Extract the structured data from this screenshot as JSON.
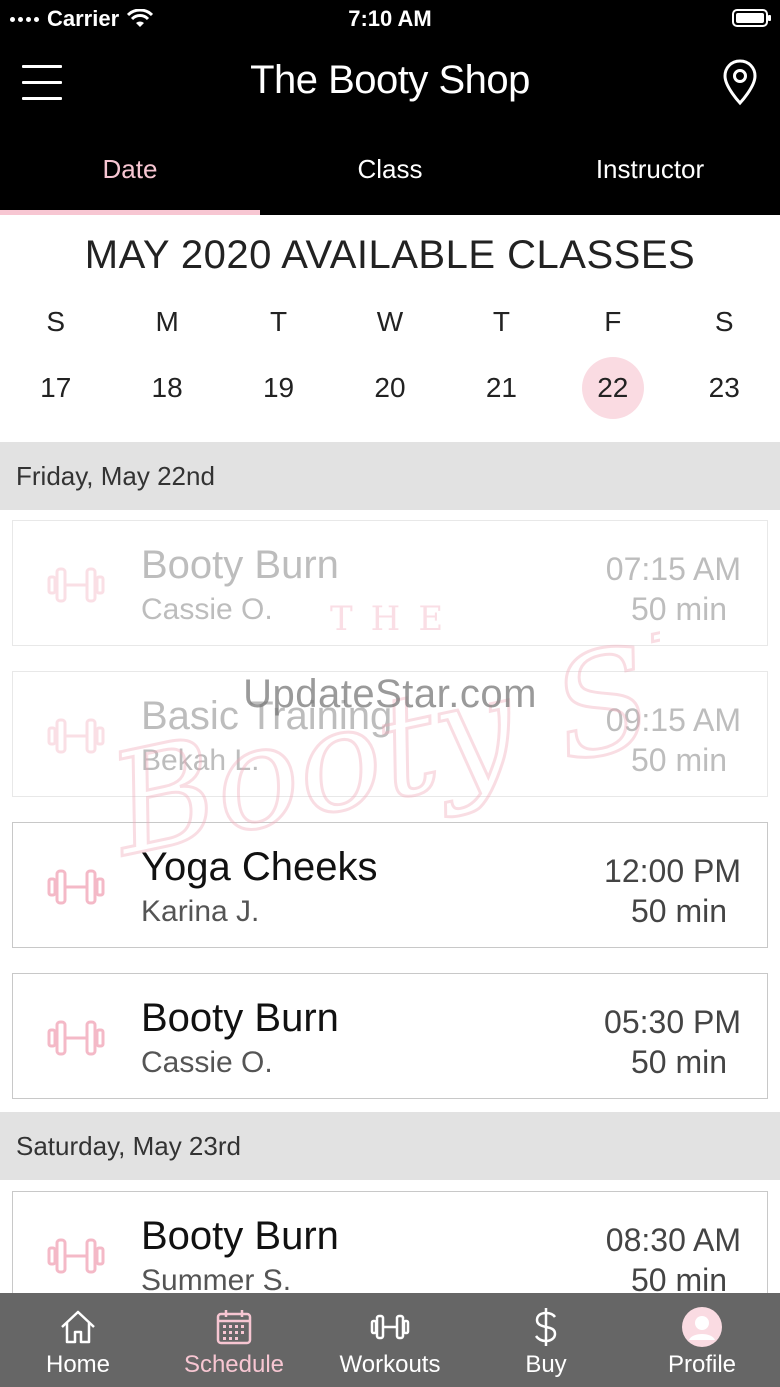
{
  "status_bar": {
    "carrier": "Carrier",
    "time": "7:10 AM"
  },
  "header": {
    "title": "The Booty Shop"
  },
  "tabs": [
    {
      "label": "Date",
      "active": true
    },
    {
      "label": "Class",
      "active": false
    },
    {
      "label": "Instructor",
      "active": false
    }
  ],
  "calendar": {
    "title": "MAY 2020 AVAILABLE CLASSES",
    "weekday_letters": [
      "S",
      "M",
      "T",
      "W",
      "T",
      "F",
      "S"
    ],
    "days": [
      "17",
      "18",
      "19",
      "20",
      "21",
      "22",
      "23"
    ],
    "selected_day": "22"
  },
  "sections": [
    {
      "date_label": "Friday, May 22nd",
      "classes": [
        {
          "name": "Booty Burn",
          "instructor": "Cassie O.",
          "time": "07:15 AM",
          "duration": "50 min",
          "past": true
        },
        {
          "name": "Basic Training",
          "instructor": "Bekah L.",
          "time": "09:15 AM",
          "duration": "50 min",
          "past": true
        },
        {
          "name": "Yoga Cheeks",
          "instructor": "Karina J.",
          "time": "12:00 PM",
          "duration": "50 min",
          "past": false
        },
        {
          "name": "Booty Burn",
          "instructor": "Cassie O.",
          "time": "05:30 PM",
          "duration": "50 min",
          "past": false
        }
      ]
    },
    {
      "date_label": "Saturday, May 23rd",
      "classes": [
        {
          "name": "Booty Burn",
          "instructor": "Summer S.",
          "time": "08:30 AM",
          "duration": "50 min",
          "past": false
        }
      ]
    }
  ],
  "watermark": {
    "site": "UpdateStar.com",
    "logo_text_top": "THE",
    "logo_text": "Booty Shop"
  },
  "bottom_nav": [
    {
      "label": "Home",
      "icon": "home-icon",
      "active": false
    },
    {
      "label": "Schedule",
      "icon": "calendar-icon",
      "active": true
    },
    {
      "label": "Workouts",
      "icon": "dumbbell-icon",
      "active": false
    },
    {
      "label": "Buy",
      "icon": "dollar-icon",
      "active": false
    },
    {
      "label": "Profile",
      "icon": "avatar-icon",
      "active": false
    }
  ],
  "colors": {
    "accent_pink": "#f7c6d2",
    "header_bg": "#000000",
    "nav_bg": "#666666",
    "section_bg": "#e2e2e2"
  }
}
